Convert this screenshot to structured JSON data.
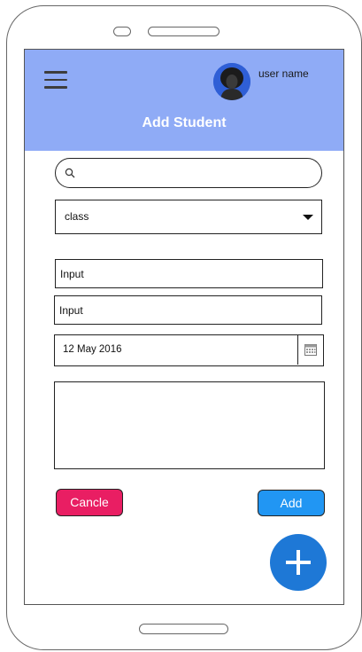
{
  "header": {
    "title": "Add Student",
    "user_name": "user name",
    "menu_icon": "hamburger-menu-icon",
    "avatar_icon": "user-avatar"
  },
  "form": {
    "search": {
      "placeholder": "",
      "value": "",
      "icon": "search-icon"
    },
    "class_select": {
      "selected": "class",
      "icon": "caret-down-icon"
    },
    "inputs": [
      {
        "value": "Input"
      },
      {
        "value": "Input"
      }
    ],
    "date": {
      "value": "12 May 2016",
      "icon": "calendar-icon"
    },
    "textarea": {
      "value": ""
    }
  },
  "actions": {
    "cancel_label": "Cancle",
    "add_label": "Add",
    "fab_icon": "plus-icon"
  },
  "colors": {
    "header_bg": "#8fabf6",
    "cancel_bg": "#e91e63",
    "add_bg": "#2196f3",
    "fab_bg": "#1e78d6"
  }
}
